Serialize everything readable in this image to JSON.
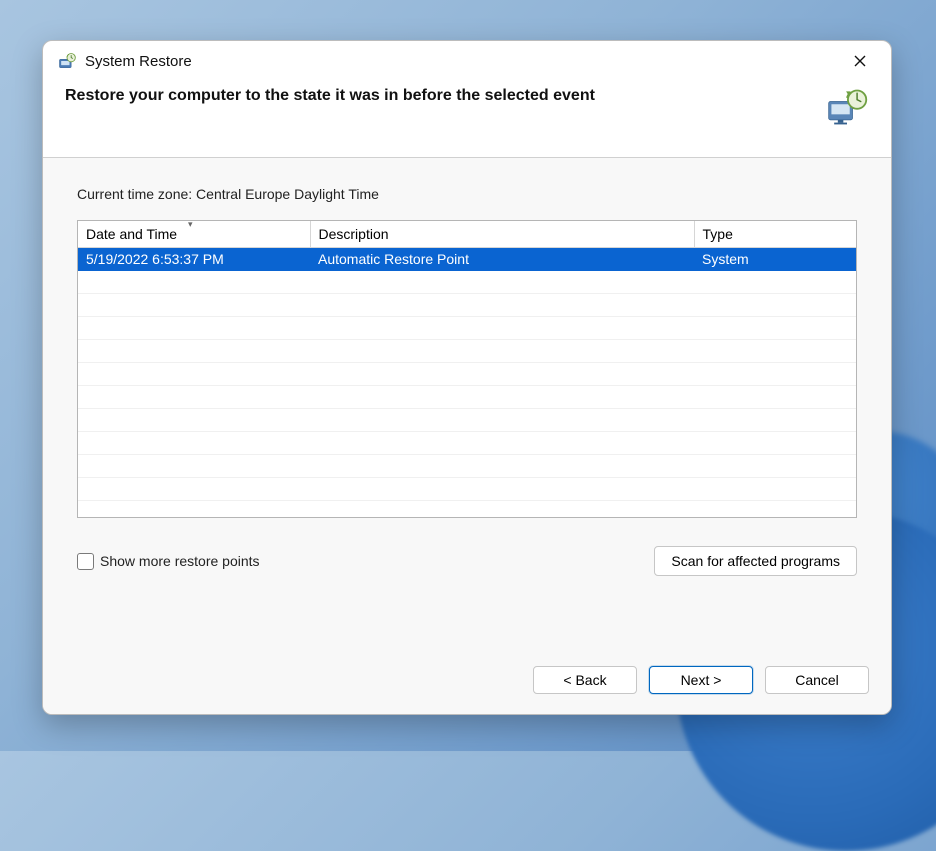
{
  "window": {
    "title": "System Restore"
  },
  "header": {
    "heading": "Restore your computer to the state it was in before the selected event"
  },
  "body": {
    "timezone_label": "Current time zone: Central Europe Daylight Time",
    "columns": {
      "date": "Date and Time",
      "description": "Description",
      "type": "Type"
    },
    "rows": [
      {
        "date": "5/19/2022 6:53:37 PM",
        "description": "Automatic Restore Point",
        "type": "System",
        "selected": true
      }
    ],
    "show_more_label": "Show more restore points",
    "scan_label": "Scan for affected programs"
  },
  "footer": {
    "back_label": "< Back",
    "next_label": "Next >",
    "cancel_label": "Cancel"
  }
}
